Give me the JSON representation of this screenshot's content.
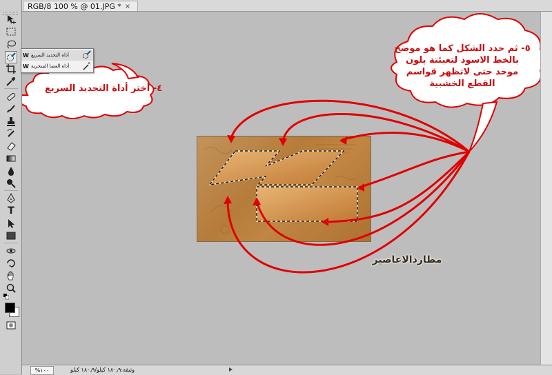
{
  "window": {
    "tab_title": "RGB/8 100 % @ 01.JPG *",
    "tab_close": "×"
  },
  "toolbar": {
    "tools": [
      {
        "name": "move-tool",
        "icon": "move-icon"
      },
      {
        "name": "marquee-tool",
        "icon": "marquee-icon"
      },
      {
        "name": "lasso-tool",
        "icon": "lasso-icon"
      },
      {
        "name": "quick-selection-tool",
        "icon": "quick-selection-icon",
        "active": true
      },
      {
        "name": "crop-tool",
        "icon": "crop-icon"
      },
      {
        "name": "eyedropper-tool",
        "icon": "eyedropper-icon"
      },
      {
        "name": "healing-brush-tool",
        "icon": "bandage-icon"
      },
      {
        "name": "brush-tool",
        "icon": "brush-icon"
      },
      {
        "name": "clone-stamp-tool",
        "icon": "stamp-icon"
      },
      {
        "name": "history-brush-tool",
        "icon": "history-brush-icon"
      },
      {
        "name": "eraser-tool",
        "icon": "eraser-icon"
      },
      {
        "name": "gradient-tool",
        "icon": "gradient-icon"
      },
      {
        "name": "blur-tool",
        "icon": "drop-icon"
      },
      {
        "name": "dodge-tool",
        "icon": "dodge-icon"
      },
      {
        "name": "pen-tool",
        "icon": "pen-icon"
      },
      {
        "name": "type-tool",
        "icon": "type-icon"
      },
      {
        "name": "path-selection-tool",
        "icon": "arrow-icon"
      },
      {
        "name": "shape-tool",
        "icon": "rectangle-icon"
      },
      {
        "name": "3d-rotate-tool",
        "icon": "3d-rotate-icon"
      },
      {
        "name": "3d-orbit-tool",
        "icon": "3d-orbit-icon"
      },
      {
        "name": "hand-tool",
        "icon": "hand-icon"
      },
      {
        "name": "zoom-tool",
        "icon": "zoom-icon"
      }
    ],
    "foreground_color": "#000000",
    "background_color": "#ffffff",
    "type_glyph": "T"
  },
  "flyout": {
    "items": [
      {
        "key": "W",
        "label": "أداة التحديد السريع",
        "selected": true,
        "icon": "quick-selection-icon"
      },
      {
        "key": "W",
        "label": "أداة العصا السحرية",
        "selected": false,
        "icon": "magic-wand-icon"
      }
    ]
  },
  "annotations": {
    "step4": "٤- أختر أداة التحديد السريع",
    "step5": "٥- ثم حدد الشكل كما هو موضح بالخط الاسود لتعبئتة بلون موحد حتى لاتظهر قواسم القطع الخشبية",
    "arrow_color": "#e00000"
  },
  "signature": "مطاردالاعاصير",
  "status": {
    "zoom": "%١٠٠",
    "doc_info": "وثيقة:١٨٠٫٩ كيلو/١٨٠٫٩ كيلو"
  },
  "colors": {
    "workspace": "#bdbdbd",
    "toolbar": "#cfcfcf",
    "callout_text": "#c81010"
  }
}
